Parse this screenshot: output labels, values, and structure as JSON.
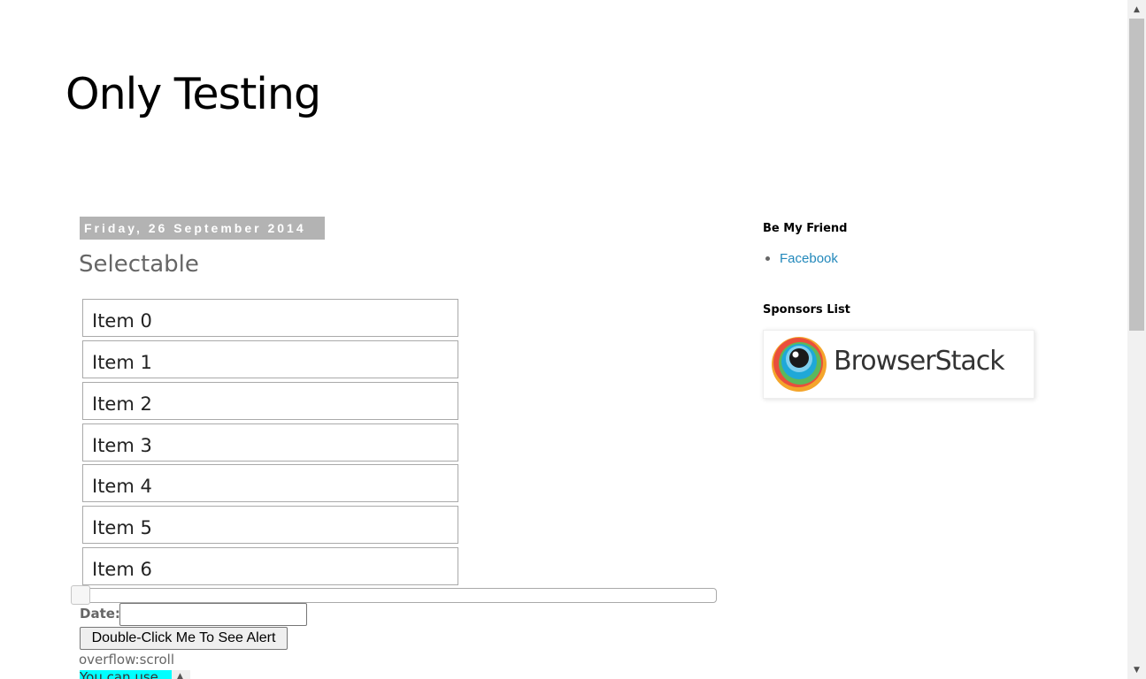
{
  "header": {
    "blog_title": "Only Testing"
  },
  "post": {
    "date": "Friday, 26 September 2014",
    "title": "Selectable",
    "selectable_items": [
      "Item 0",
      "Item 1",
      "Item 2",
      "Item 3",
      "Item 4",
      "Item 5",
      "Item 6"
    ],
    "slider": {
      "value_percent": 0
    },
    "date_field": {
      "label": "Date:",
      "value": ""
    },
    "double_click_button": "Double-Click Me To See Alert",
    "overflow_label": "overflow:scroll",
    "scroll_box_text": "You can use"
  },
  "sidebar": {
    "friend_widget": {
      "title": "Be My Friend",
      "links": [
        "Facebook"
      ]
    },
    "sponsor_widget": {
      "title": "Sponsors List",
      "sponsor_name": "BrowserStack"
    }
  },
  "icons": {
    "browserstack_logo": "browserstack-logo-icon",
    "scroll_up": "arrow-up-icon",
    "scroll_down": "arrow-down-icon"
  },
  "colors": {
    "date_header_bg": "#b3b3b3",
    "link": "#2288bb",
    "scroll_text_bg": "#00ffff"
  }
}
